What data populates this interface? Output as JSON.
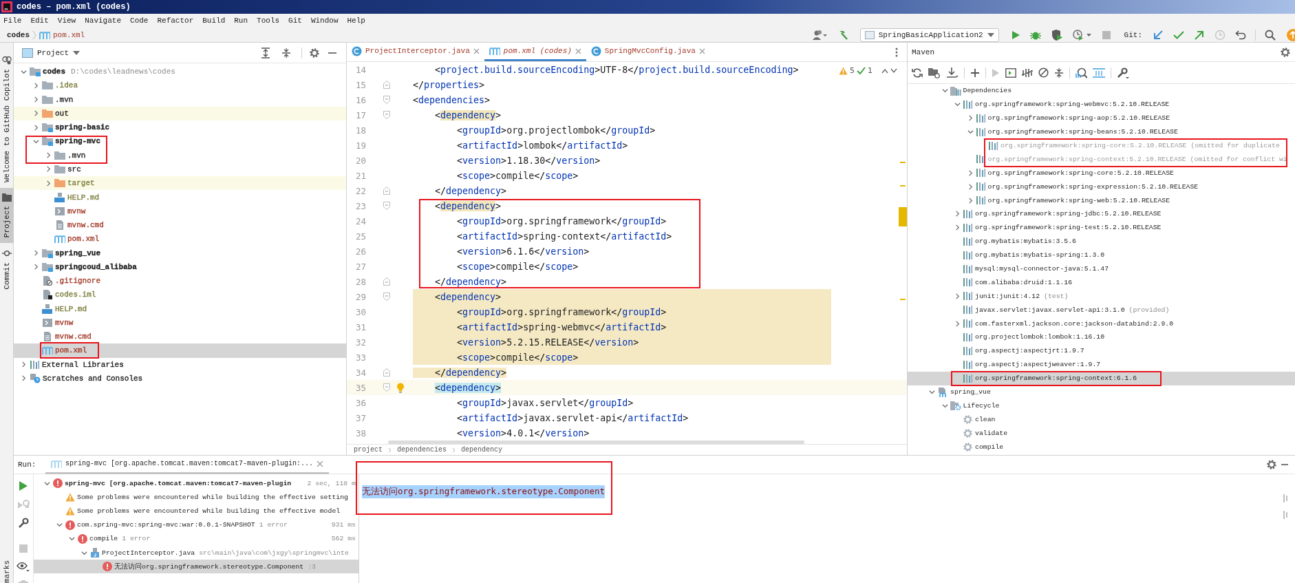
{
  "window": {
    "title": "codes – pom.xml (codes)"
  },
  "menu": [
    "File",
    "Edit",
    "View",
    "Navigate",
    "Code",
    "Refactor",
    "Build",
    "Run",
    "Tools",
    "Git",
    "Window",
    "Help"
  ],
  "navbar": {
    "project": "codes",
    "file": "pom.xml"
  },
  "toolbar": {
    "run_config": "SpringBasicApplication2",
    "git_label": "Git:"
  },
  "tool_strip": [
    {
      "label": "Welcome to GitHub Copilot",
      "kind": "copilot",
      "selected": false
    },
    {
      "label": "Project",
      "kind": "project",
      "selected": true
    },
    {
      "label": "Commit",
      "kind": "commit",
      "selected": false
    }
  ],
  "bottom_strip_label": "marks",
  "project_panel": {
    "title": "Project",
    "tree": [
      {
        "name": "codes",
        "kind": "module",
        "color": "#1f1f1f",
        "path": "D:\\codes\\leadnews\\codes",
        "expanded": true,
        "selected": false,
        "children": [
          {
            "name": ".idea",
            "kind": "folder",
            "color": "#7d7d3c",
            "expanded": false,
            "selected": false
          },
          {
            "name": ".mvn",
            "kind": "folder",
            "color": "#1f1f1f",
            "expanded": false,
            "selected": false
          },
          {
            "name": "out",
            "kind": "excluded",
            "color": "#1f1f1f",
            "expanded": false,
            "selected": false
          },
          {
            "name": "spring-basic",
            "kind": "module",
            "color": "#1f1f1f",
            "expanded": false,
            "selected": false
          },
          {
            "name": "spring-mvc",
            "kind": "module",
            "color": "#1f1f1f",
            "expanded": true,
            "selected": false,
            "children": [
              {
                "name": ".mvn",
                "kind": "folder",
                "color": "#1f1f1f",
                "expanded": false,
                "selected": false
              },
              {
                "name": "src",
                "kind": "folder",
                "color": "#1f1f1f",
                "expanded": false,
                "selected": false
              },
              {
                "name": "target",
                "kind": "excluded",
                "color": "#7d7d3c",
                "expanded": false,
                "selected": false
              },
              {
                "name": "HELP.md",
                "kind": "md",
                "color": "#7d7d3c",
                "selected": false
              },
              {
                "name": "mvnw",
                "kind": "script",
                "color": "#a33b2a",
                "selected": false
              },
              {
                "name": "mvnw.cmd",
                "kind": "cmd",
                "color": "#a33b2a",
                "selected": false
              },
              {
                "name": "pom.xml",
                "kind": "maven",
                "color": "#a33b2a",
                "selected": false
              }
            ]
          },
          {
            "name": "spring_vue",
            "kind": "module",
            "color": "#1f1f1f",
            "expanded": false,
            "selected": false
          },
          {
            "name": "springcoud_alibaba",
            "kind": "module",
            "color": "#1f1f1f",
            "expanded": false,
            "selected": false
          },
          {
            "name": ".gitignore",
            "kind": "gitignore",
            "color": "#a33b2a",
            "selected": false
          },
          {
            "name": "codes.iml",
            "kind": "iml",
            "color": "#7d7d3c",
            "selected": false
          },
          {
            "name": "HELP.md",
            "kind": "md",
            "color": "#7d7d3c",
            "selected": false
          },
          {
            "name": "mvnw",
            "kind": "script",
            "color": "#a33b2a",
            "selected": false
          },
          {
            "name": "mvnw.cmd",
            "kind": "cmd",
            "color": "#a33b2a",
            "selected": false
          },
          {
            "name": "pom.xml",
            "kind": "maven",
            "color": "#a33b2a",
            "selected": true
          }
        ]
      },
      {
        "name": "External Libraries",
        "kind": "libraries",
        "color": "#1f1f1f",
        "expanded": false,
        "selected": false
      },
      {
        "name": "Scratches and Consoles",
        "kind": "scratches",
        "color": "#1f1f1f",
        "expanded": false,
        "selected": false
      }
    ]
  },
  "editor": {
    "tabs": [
      {
        "label": "ProjectInterceptor.java",
        "kind": "class",
        "selected": false
      },
      {
        "label": "pom.xml (codes)",
        "kind": "maven",
        "selected": true
      },
      {
        "label": "SpringMvcConfig.java",
        "kind": "class",
        "selected": false
      }
    ],
    "warnings": "5",
    "weak_warnings": "1",
    "lines": [
      {
        "number": "14",
        "text": "    <project.build.sourceEncoding>UTF-8</project.build.sourceEncoding>",
        "kind": "plain",
        "fold_start": false,
        "fold_end": false
      },
      {
        "number": "15",
        "text": "</properties>",
        "kind": "plain",
        "fold_start": false,
        "fold_end": true
      },
      {
        "number": "16",
        "text": "<dependencies>",
        "kind": "plain",
        "fold_start": true,
        "fold_end": false
      },
      {
        "number": "17",
        "text": "    <dependency>",
        "kind": "match",
        "fold_start": true,
        "fold_end": false
      },
      {
        "number": "18",
        "text": "        <groupId>org.projectlombok</groupId>",
        "kind": "plain",
        "fold_start": false,
        "fold_end": false
      },
      {
        "number": "19",
        "text": "        <artifactId>lombok</artifactId>",
        "kind": "plain",
        "fold_start": false,
        "fold_end": false
      },
      {
        "number": "20",
        "text": "        <version>1.18.30</version>",
        "kind": "plain",
        "fold_start": false,
        "fold_end": false
      },
      {
        "number": "21",
        "text": "        <scope>compile</scope>",
        "kind": "plain",
        "fold_start": false,
        "fold_end": false
      },
      {
        "number": "22",
        "text": "    </dependency>",
        "kind": "plain",
        "fold_start": false,
        "fold_end": true
      },
      {
        "number": "23",
        "text": "    <dependency>",
        "kind": "match",
        "fold_start": true,
        "fold_end": false
      },
      {
        "number": "24",
        "text": "        <groupId>org.springframework</groupId>",
        "kind": "plain",
        "fold_start": false,
        "fold_end": false
      },
      {
        "number": "25",
        "text": "        <artifactId>spring-context</artifactId>",
        "kind": "plain",
        "fold_start": false,
        "fold_end": false
      },
      {
        "number": "26",
        "text": "        <version>6.1.6</version>",
        "kind": "plain",
        "fold_start": false,
        "fold_end": false
      },
      {
        "number": "27",
        "text": "        <scope>compile</scope>",
        "kind": "plain",
        "fold_start": false,
        "fold_end": false
      },
      {
        "number": "28",
        "text": "    </dependency>",
        "kind": "plain",
        "fold_start": false,
        "fold_end": true
      },
      {
        "number": "29",
        "text": "    <dependency>",
        "kind": "block",
        "fold_start": true,
        "fold_end": false
      },
      {
        "number": "30",
        "text": "        <groupId>org.springframework</groupId>",
        "kind": "block",
        "fold_start": false,
        "fold_end": false
      },
      {
        "number": "31",
        "text": "        <artifactId>spring-webmvc</artifactId>",
        "kind": "block",
        "fold_start": false,
        "fold_end": false
      },
      {
        "number": "32",
        "text": "        <version>5.2.15.RELEASE</version>",
        "kind": "block",
        "fold_start": false,
        "fold_end": false
      },
      {
        "number": "33",
        "text": "        <scope>compile</scope>",
        "kind": "block",
        "fold_start": false,
        "fold_end": false
      },
      {
        "number": "34",
        "text": "    </dependency>",
        "kind": "blockend",
        "fold_start": false,
        "fold_end": true
      },
      {
        "number": "35",
        "text": "    <dependency>",
        "kind": "current",
        "fold_start": true,
        "fold_end": false
      },
      {
        "number": "36",
        "text": "        <groupId>javax.servlet</groupId>",
        "kind": "plain",
        "fold_start": false,
        "fold_end": false
      },
      {
        "number": "37",
        "text": "        <artifactId>javax.servlet-api</artifactId>",
        "kind": "plain",
        "fold_start": false,
        "fold_end": false
      },
      {
        "number": "38",
        "text": "        <version>4.0.1</version>",
        "kind": "plain",
        "fold_start": false,
        "fold_end": false
      }
    ],
    "breadcrumbs": [
      "project",
      "dependencies",
      "dependency"
    ]
  },
  "maven": {
    "title": "Maven",
    "tree": [
      {
        "name": "Dependencies",
        "kind": "deps",
        "expanded": true,
        "selected": false,
        "children": [
          {
            "name": "org.springframework:spring-webmvc:5.2.10.RELEASE",
            "kind": "library",
            "omitted": false,
            "expanded": true,
            "selected": false,
            "children": [
              {
                "name": "org.springframework:spring-aop:5.2.10.RELEASE",
                "kind": "library",
                "omitted": false,
                "expanded": false,
                "selected": false
              },
              {
                "name": "org.springframework:spring-beans:5.2.10.RELEASE",
                "kind": "library",
                "omitted": false,
                "expanded": true,
                "selected": false,
                "children": [
                  {
                    "name": "org.springframework:spring-core:5.2.10.RELEASE",
                    "note": "(omitted for duplicate",
                    "kind": "library",
                    "omitted": true,
                    "selected": false
                  }
                ]
              },
              {
                "name": "org.springframework:spring-context:5.2.10.RELEASE",
                "note": "(omitted for conflict wi",
                "kind": "library",
                "omitted": true,
                "selected": false
              },
              {
                "name": "org.springframework:spring-core:5.2.10.RELEASE",
                "kind": "library",
                "omitted": false,
                "expanded": false,
                "selected": false
              },
              {
                "name": "org.springframework:spring-expression:5.2.10.RELEASE",
                "kind": "library",
                "omitted": false,
                "expanded": false,
                "selected": false
              },
              {
                "name": "org.springframework:spring-web:5.2.10.RELEASE",
                "kind": "library",
                "omitted": false,
                "expanded": false,
                "selected": false
              }
            ]
          },
          {
            "name": "org.springframework:spring-jdbc:5.2.10.RELEASE",
            "kind": "library",
            "omitted": false,
            "expanded": false,
            "selected": false
          },
          {
            "name": "org.springframework:spring-test:5.2.10.RELEASE",
            "kind": "library",
            "omitted": false,
            "expanded": false,
            "selected": false
          },
          {
            "name": "org.mybatis:mybatis:3.5.6",
            "kind": "library",
            "omitted": false,
            "selected": false
          },
          {
            "name": "org.mybatis:mybatis-spring:1.3.0",
            "kind": "library",
            "omitted": false,
            "selected": false
          },
          {
            "name": "mysql:mysql-connector-java:5.1.47",
            "kind": "library",
            "omitted": false,
            "selected": false
          },
          {
            "name": "com.alibaba:druid:1.1.16",
            "kind": "library",
            "omitted": false,
            "selected": false
          },
          {
            "name": "junit:junit:4.12",
            "note": "(test)",
            "kind": "library",
            "omitted": false,
            "expanded": false,
            "selected": false
          },
          {
            "name": "javax.servlet:javax.servlet-api:3.1.0",
            "note": "(provided)",
            "kind": "library",
            "omitted": false,
            "selected": false
          },
          {
            "name": "com.fasterxml.jackson.core:jackson-databind:2.9.0",
            "kind": "library",
            "omitted": false,
            "expanded": false,
            "selected": false
          },
          {
            "name": "org.projectlombok:lombok:1.16.10",
            "kind": "library",
            "omitted": false,
            "selected": false
          },
          {
            "name": "org.aspectj:aspectjrt:1.9.7",
            "kind": "library",
            "omitted": false,
            "selected": false
          },
          {
            "name": "org.aspectj:aspectjweaver:1.9.7",
            "kind": "library",
            "omitted": false,
            "selected": false
          },
          {
            "name": "org.springframework:spring-context:6.1.6",
            "kind": "library",
            "omitted": false,
            "selected": true
          }
        ]
      },
      {
        "name": "spring_vue",
        "kind": "module",
        "expanded": true,
        "selected": false,
        "children": [
          {
            "name": "Lifecycle",
            "kind": "lifecycle",
            "expanded": true,
            "selected": false,
            "children": [
              {
                "name": "clean",
                "kind": "goal",
                "selected": false
              },
              {
                "name": "validate",
                "kind": "goal",
                "selected": false
              },
              {
                "name": "compile",
                "kind": "goal",
                "selected": false
              }
            ]
          }
        ]
      }
    ]
  },
  "run": {
    "label": "Run:",
    "tab": {
      "title": "spring-mvc [org.apache.tomcat.maven:tomcat7-maven-plugin:...",
      "selected": true
    },
    "tree": [
      {
        "kind": "root",
        "text": "spring-mvc [org.apache.tomcat.maven:tomcat7-maven-plugin",
        "time": "2 sec, 118 m",
        "expanded": true,
        "selected": false,
        "children": [
          {
            "kind": "warning",
            "text": "Some problems were encountered while building the effective setting",
            "selected": false
          },
          {
            "kind": "warning",
            "text": "Some problems were encountered while building the effective model",
            "selected": false
          },
          {
            "kind": "error",
            "text": "com.spring-mvc:spring-mvc:war:0.0.1-SNAPSHOT",
            "detail": "1 error",
            "time": "931 ms",
            "expanded": true,
            "selected": false,
            "children": [
              {
                "kind": "error",
                "text": "compile",
                "detail": "1 error",
                "time": "562 ms",
                "expanded": true,
                "selected": false,
                "children": [
                  {
                    "kind": "file",
                    "text": "ProjectInterceptor.java",
                    "detail": "src\\main\\java\\com\\jxgy\\springmvc\\inte",
                    "expanded": true,
                    "selected": false,
                    "children": [
                      {
                        "kind": "message",
                        "text": "无法访问org.springframework.stereotype.Component",
                        "detail": ":3",
                        "selected": true
                      }
                    ]
                  }
                ]
              }
            ]
          }
        ]
      }
    ],
    "console": [
      {
        "text": "无法访问org.springframework.stereotype.Component",
        "selected": true
      }
    ]
  }
}
